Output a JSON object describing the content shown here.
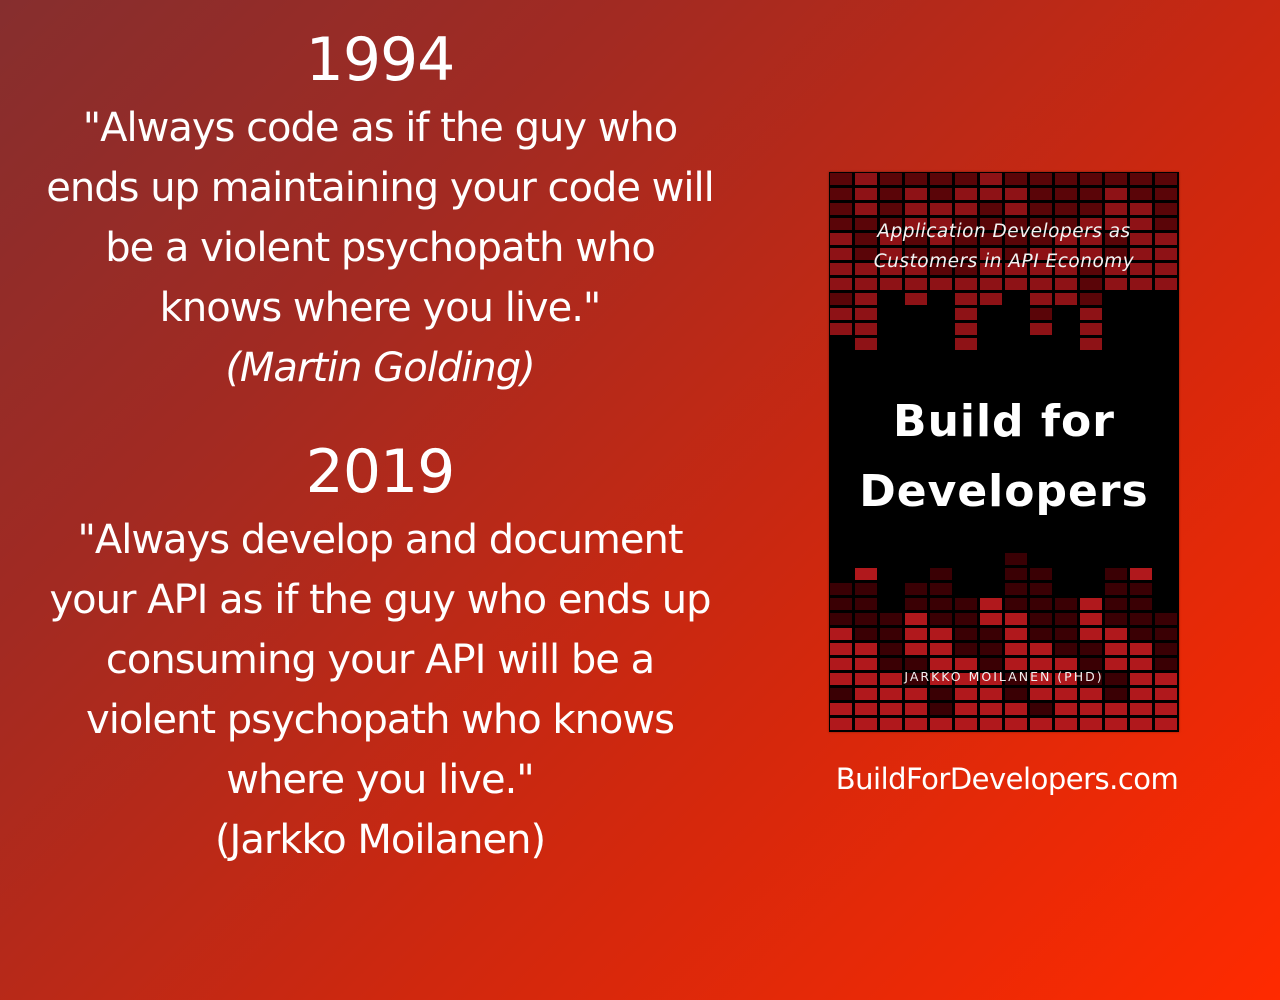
{
  "section_1994": {
    "year": "1994",
    "quote_lines": [
      "\"Always code as if the guy who",
      "ends up maintaining your code will",
      "be a violent psychopath who",
      "knows where you live.\""
    ],
    "author": "(Martin Golding)"
  },
  "section_2019": {
    "year": "2019",
    "quote_lines": [
      "\"Always develop and document",
      "your API as if the guy who ends up",
      "consuming your API will be a",
      "violent psychopath who knows",
      "where you live.\""
    ],
    "author": "(Jarkko Moilanen)"
  },
  "book": {
    "subtitle_lines": [
      "Application Developers as",
      "Customers in API Economy"
    ],
    "title_lines": [
      "Build for",
      "Developers"
    ],
    "author": "JARKKO MOILANEN (PHD)",
    "colors": {
      "background": "#000000",
      "block_light": "#b0181c",
      "block_dark": "#3a0004"
    }
  },
  "website": "BuildForDevelopers.com",
  "colors": {
    "gradient_start": "#862e2e",
    "gradient_end": "#ff2a00",
    "text": "#ffffff"
  }
}
